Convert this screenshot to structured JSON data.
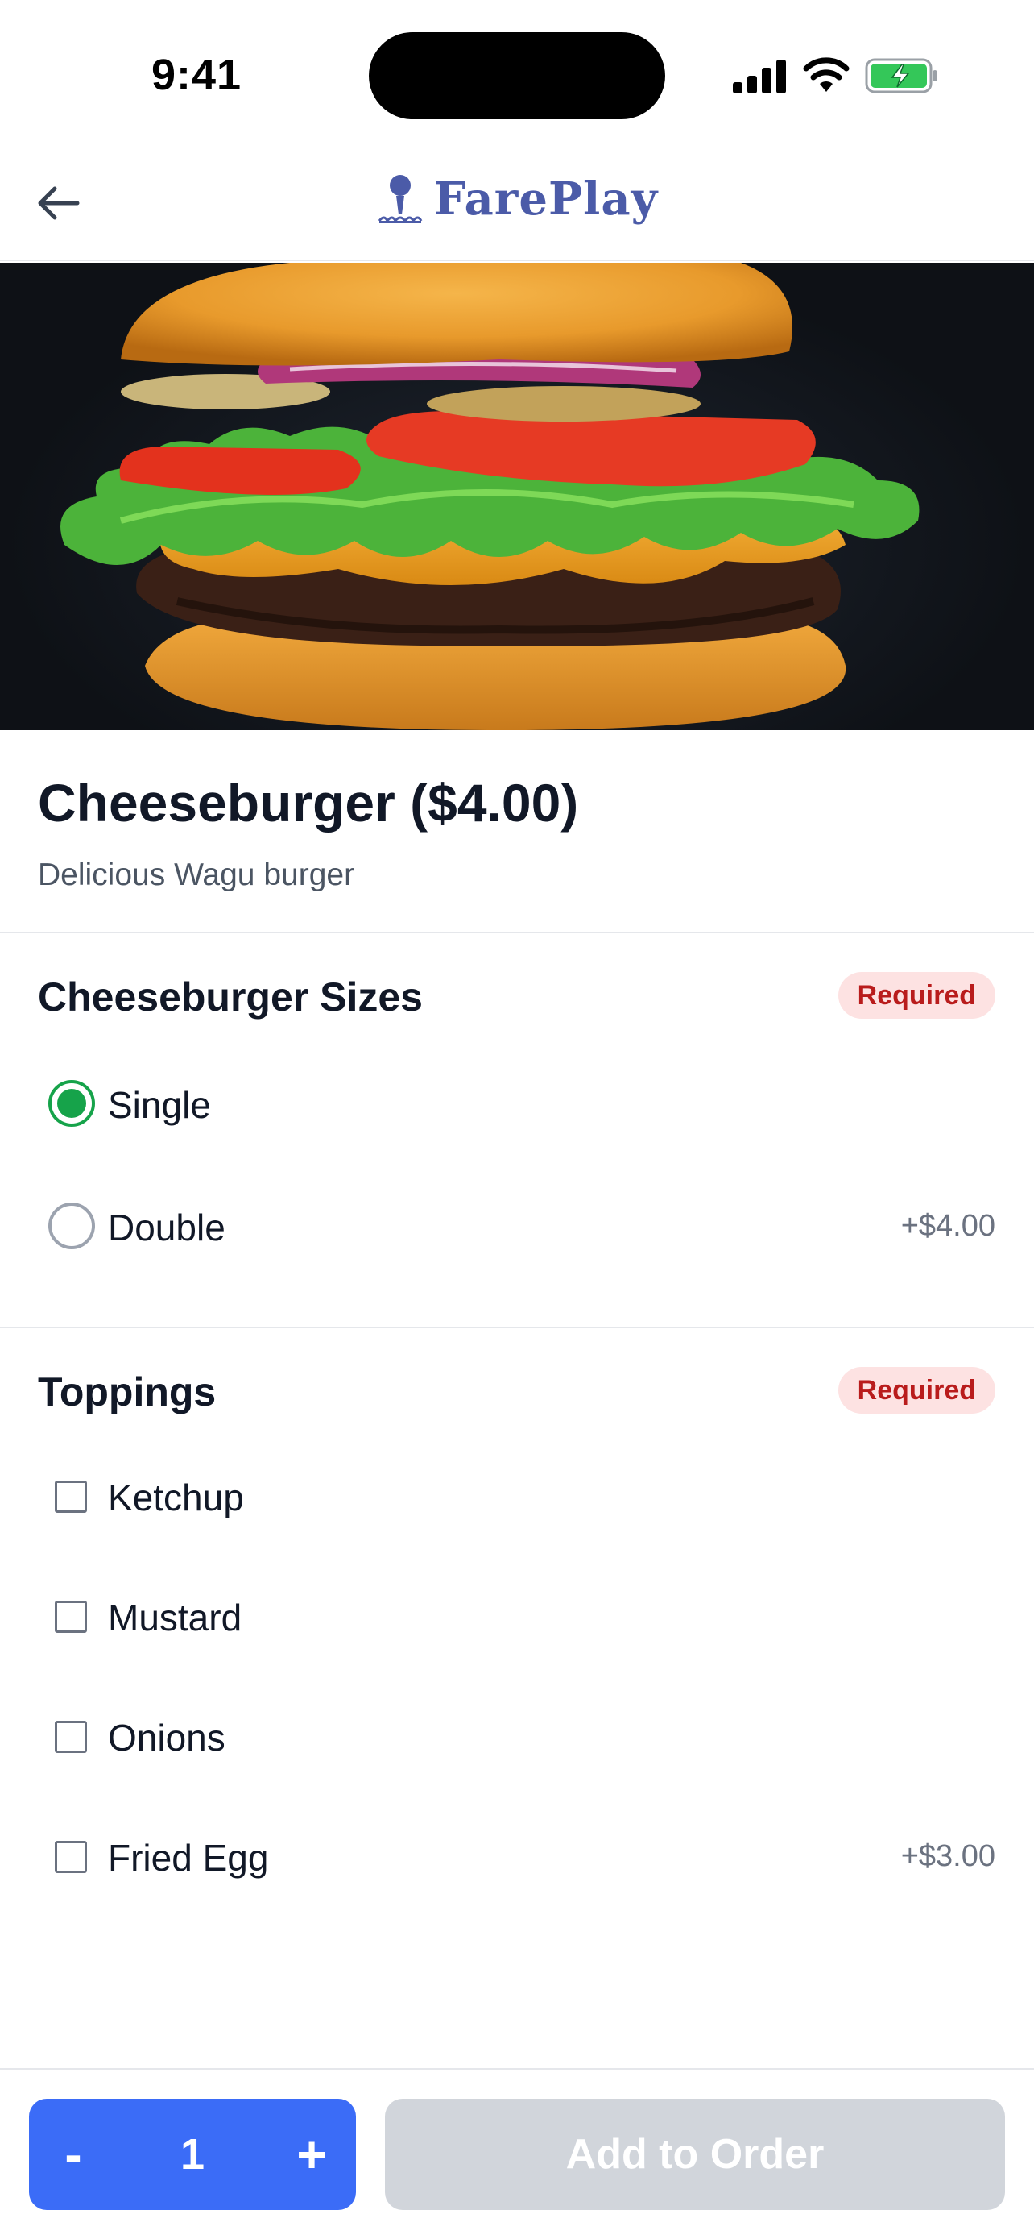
{
  "status_bar": {
    "time": "9:41",
    "battery_color": "#34c759"
  },
  "header": {
    "back_icon": "arrow-left-icon",
    "brand_name": "FarePlay",
    "brand_color": "#4b5ba8"
  },
  "hero": {
    "image": "cheeseburger-photo"
  },
  "product": {
    "title": "Cheeseburger ($4.00)",
    "description": "Delicious Wagu burger"
  },
  "sizes": {
    "title": "Cheeseburger Sizes",
    "badge": "Required",
    "options": [
      {
        "label": "Single",
        "price": "",
        "selected": true
      },
      {
        "label": "Double",
        "price": "+$4.00",
        "selected": false
      }
    ]
  },
  "toppings": {
    "title": "Toppings",
    "badge": "Required",
    "options": [
      {
        "label": "Ketchup",
        "price": "",
        "checked": false
      },
      {
        "label": "Mustard",
        "price": "",
        "checked": false
      },
      {
        "label": "Onions",
        "price": "",
        "checked": false
      },
      {
        "label": "Fried Egg",
        "price": "+$3.00",
        "checked": false
      }
    ]
  },
  "footer": {
    "minus_label": "-",
    "quantity": "1",
    "plus_label": "+",
    "add_label": "Add to Order",
    "accent_color": "#3b6cf7",
    "disabled_color": "#d1d5db"
  }
}
